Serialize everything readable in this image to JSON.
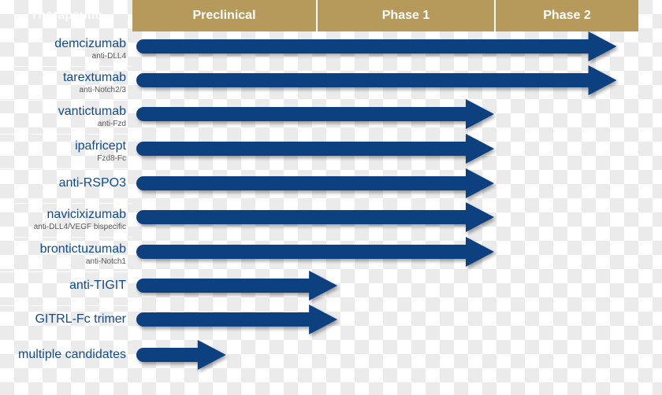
{
  "header": {
    "left_label": "Therapeutic",
    "phases": [
      "Preclinical",
      "Phase 1",
      "Phase 2"
    ]
  },
  "colors": {
    "header_gold": "#b59a5c",
    "arrow_navy": "#0f3f7e",
    "name_blue": "#124a8a",
    "sub_gray": "#555555"
  },
  "rows": [
    {
      "name": "demcizumab",
      "sub": "anti-DLL4",
      "progress_phase_end": 2.85
    },
    {
      "name": "tarextumab",
      "sub": "anti-Notch2/3",
      "progress_phase_end": 2.85
    },
    {
      "name": "vantictumab",
      "sub": "anti-Fzd",
      "progress_phase_end": 2.0
    },
    {
      "name": "ipafricept",
      "sub": "Fzd8-Fc",
      "progress_phase_end": 2.0
    },
    {
      "name": "anti-RSPO3",
      "sub": "",
      "progress_phase_end": 2.0
    },
    {
      "name": "navicixizumab",
      "sub": "anti-DLL4/VEGF bispecific",
      "progress_phase_end": 2.0
    },
    {
      "name": "brontictuzumab",
      "sub": "anti-Notch1",
      "progress_phase_end": 2.0
    },
    {
      "name": "anti-TIGIT",
      "sub": "",
      "progress_phase_end": 1.12
    },
    {
      "name": "GITRL-Fc trimer",
      "sub": "",
      "progress_phase_end": 1.12
    },
    {
      "name": "multiple candidates",
      "sub": "",
      "progress_phase_end": 0.51
    }
  ]
}
